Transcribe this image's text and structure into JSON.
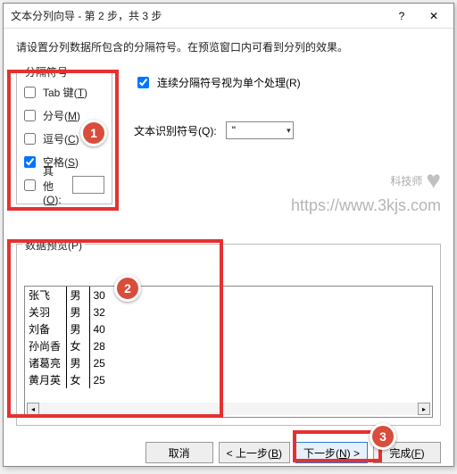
{
  "title": "文本分列向导 - 第 2 步，共 3 步",
  "instruction": "请设置分列数据所包含的分隔符号。在预览窗口内可看到分列的效果。",
  "delimiters_legend": "分隔符号",
  "delimiters": {
    "tab": {
      "label": "Tab 键(",
      "key": "T",
      "tail": ")",
      "checked": false
    },
    "semicolon": {
      "label": "分号(",
      "key": "M",
      "tail": ")",
      "checked": false
    },
    "comma": {
      "label": "逗号(",
      "key": "C",
      "tail": ")",
      "checked": false
    },
    "space": {
      "label": "空格(",
      "key": "S",
      "tail": ")",
      "checked": true
    },
    "other": {
      "label": "其他(",
      "key": "O",
      "tail": "):",
      "checked": false,
      "value": ""
    }
  },
  "treat_consecutive": {
    "label": "连续分隔符号视为单个处理(",
    "key": "R",
    "tail": ")",
    "checked": true
  },
  "text_qualifier": {
    "label": "文本识别符号(",
    "key": "Q",
    "tail": "):",
    "value": "\""
  },
  "preview_legend_pre": "数据预览(",
  "preview_legend_key": "P",
  "preview_legend_post": ")",
  "preview_rows": [
    [
      "张飞",
      "男",
      "30"
    ],
    [
      "关羽",
      "男",
      "32"
    ],
    [
      "刘备",
      "男",
      "40"
    ],
    [
      "孙尚香",
      "女",
      "28"
    ],
    [
      "诸葛亮",
      "男",
      "25"
    ],
    [
      "黄月英",
      "女",
      "25"
    ]
  ],
  "buttons": {
    "cancel": "取消",
    "back_pre": "< 上一步(",
    "back_key": "B",
    "back_post": ")",
    "next_pre": "下一步(",
    "next_key": "N",
    "next_post": ") >",
    "finish_pre": "完成(",
    "finish_key": "F",
    "finish_post": ")"
  },
  "callouts": {
    "n1": "1",
    "n2": "2",
    "n3": "3"
  },
  "watermark": {
    "brand": "科技师",
    "url": "https://www.3kjs.com"
  }
}
